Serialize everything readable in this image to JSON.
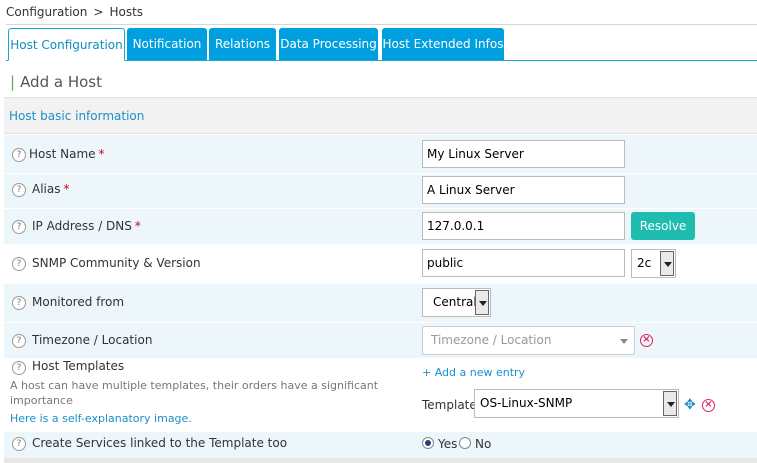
{
  "breadcrumb": {
    "part1": "Configuration",
    "sep": ">",
    "part2": "Hosts"
  },
  "tabs": [
    {
      "label": "Host Configuration",
      "active": true
    },
    {
      "label": "Notification"
    },
    {
      "label": "Relations"
    },
    {
      "label": "Data Processing"
    },
    {
      "label": "Host Extended Infos"
    }
  ],
  "page_title": "Add a Host",
  "section_title": "Host basic information",
  "help_glyph": "?",
  "form": {
    "host_name": {
      "label": "Host Name",
      "required": "*",
      "value": "My Linux Server"
    },
    "alias": {
      "label": "Alias",
      "required": "*",
      "value": "A Linux Server"
    },
    "ip": {
      "label": "IP Address / DNS",
      "required": "*",
      "value": "127.0.0.1",
      "resolve_label": "Resolve"
    },
    "snmp": {
      "label": "SNMP Community & Version",
      "community_value": "public",
      "version_value": "2c"
    },
    "monitored_from": {
      "label": "Monitored from",
      "value": "Central"
    },
    "timezone": {
      "label": "Timezone / Location",
      "placeholder": "Timezone / Location"
    },
    "templates": {
      "label": "Host Templates",
      "help_text": "A host can have multiple templates, their orders have a significant importance",
      "help_link": "Here is a self-explanatory image.",
      "add_entry": "+ Add a new entry",
      "template_label": "Template",
      "template_value": "OS-Linux-SNMP"
    },
    "create_services": {
      "label": "Create Services linked to the Template too",
      "yes": "Yes",
      "no": "No",
      "selected": "yes"
    }
  },
  "colors": {
    "tab_blue": "#009fdf",
    "resolve_teal": "#1fbcb0",
    "link_blue": "#1b90c7",
    "remove_red": "#e0245e",
    "row_alt": "#ecf6fb"
  },
  "icons": {
    "help": "question-circle-icon",
    "remove": "remove-circle-icon",
    "move": "move-arrows-icon"
  }
}
